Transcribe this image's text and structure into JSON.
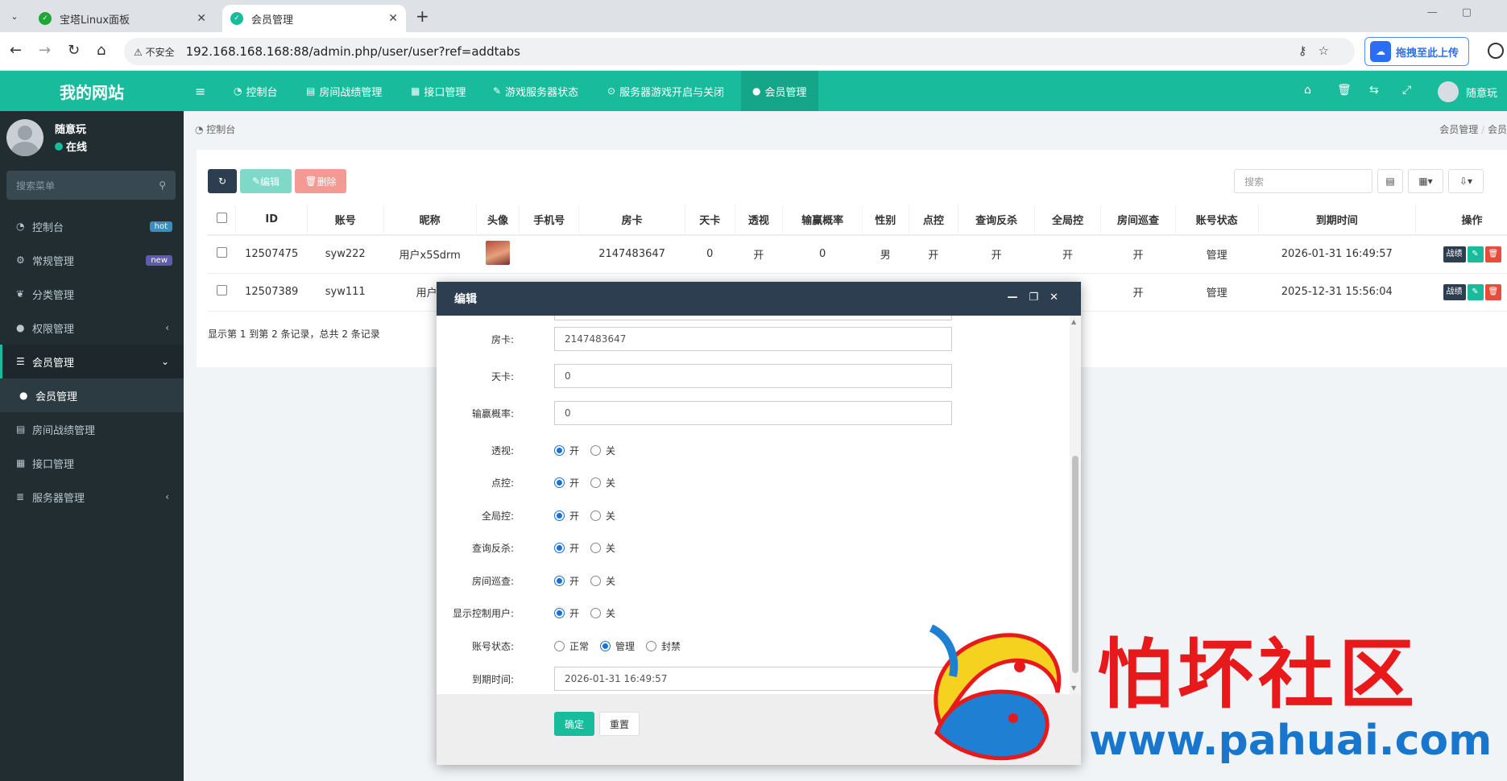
{
  "browser": {
    "tabs": [
      {
        "title": "宝塔Linux面板",
        "fav_color": "#20a53a"
      },
      {
        "title": "会员管理",
        "fav_color": "#18bc9c"
      }
    ],
    "insecure_label": "不安全",
    "url": "192.168.168.168:88/admin.php/user/user?ref=addtabs",
    "extension_label": "拖拽至此上传"
  },
  "app": {
    "site_name": "我的网站",
    "top_nav": [
      "控制台",
      "房间战绩管理",
      "接口管理",
      "游戏服务器状态",
      "服务器游戏开启与关闭",
      "会员管理"
    ],
    "user_name": "随意玩"
  },
  "sidebar": {
    "user_name": "随意玩",
    "status": "在线",
    "search_placeholder": "搜索菜单",
    "items": [
      {
        "label": "控制台",
        "badge": "hot",
        "badge_color": "#3c8dbc"
      },
      {
        "label": "常规管理",
        "badge": "new",
        "badge_color": "#605ca8"
      },
      {
        "label": "分类管理"
      },
      {
        "label": "权限管理"
      },
      {
        "label": "会员管理"
      },
      {
        "label": "会员管理"
      },
      {
        "label": "房间战绩管理"
      },
      {
        "label": "接口管理"
      },
      {
        "label": "服务器管理"
      }
    ]
  },
  "breadcrumb": {
    "left": "控制台",
    "right": "会员管理",
    "right_extra": "会员"
  },
  "toolbar": {
    "edit_label": "编辑",
    "delete_label": "删除",
    "search_placeholder": "搜索"
  },
  "table": {
    "columns": [
      "ID",
      "账号",
      "昵称",
      "头像",
      "手机号",
      "房卡",
      "天卡",
      "透视",
      "输赢概率",
      "性别",
      "点控",
      "查询反杀",
      "全局控",
      "房间巡查",
      "账号状态",
      "到期时间",
      "操作"
    ],
    "rows": [
      {
        "id": "12507475",
        "account": "syw222",
        "nickname": "用户x5Sdrm",
        "phone": "",
        "room_card": "2147483647",
        "day_card": "0",
        "perspective": "开",
        "win_rate": "0",
        "gender": "男",
        "point_ctrl": "开",
        "query_kill": "开",
        "global_ctrl": "开",
        "patrol": "开",
        "acct_status": "管理",
        "expire": "2026-01-31 16:49:57"
      },
      {
        "id": "12507389",
        "account": "syw111",
        "nickname": "用户e",
        "patrol": "开",
        "acct_status": "管理",
        "expire": "2025-12-31 15:56:04"
      }
    ],
    "op_labels": {
      "record": "战绩"
    },
    "records_text": "显示第 1 到第 2 条记录，总共 2 条记录"
  },
  "modal": {
    "title": "编辑",
    "fields": {
      "room_card": {
        "label": "房卡:",
        "value": "2147483647"
      },
      "day_card": {
        "label": "天卡:",
        "value": "0"
      },
      "win_rate": {
        "label": "输赢概率:",
        "value": "0"
      },
      "expire": {
        "label": "到期时间:",
        "value": "2026-01-31 16:49:57"
      }
    },
    "radios": [
      {
        "label": "透视:",
        "on": "开",
        "off": "关",
        "selected": "开"
      },
      {
        "label": "点控:",
        "on": "开",
        "off": "关",
        "selected": "开"
      },
      {
        "label": "全局控:",
        "on": "开",
        "off": "关",
        "selected": "开"
      },
      {
        "label": "查询反杀:",
        "on": "开",
        "off": "关",
        "selected": "开"
      },
      {
        "label": "房间巡查:",
        "on": "开",
        "off": "关",
        "selected": "开"
      },
      {
        "label": "显示控制用户:",
        "on": "开",
        "off": "关",
        "selected": "开"
      }
    ],
    "account_status": {
      "label": "账号状态:",
      "options": [
        "正常",
        "管理",
        "封禁"
      ],
      "selected": "管理"
    },
    "ok_label": "确定",
    "reset_label": "重置"
  },
  "watermark": {
    "text": "怕坏社区",
    "url": "www.pahuai.com"
  },
  "colors": {
    "brand": "#18bc9c",
    "sidebar": "#222d32",
    "dark": "#2c3e50",
    "danger": "#e74c3c"
  }
}
